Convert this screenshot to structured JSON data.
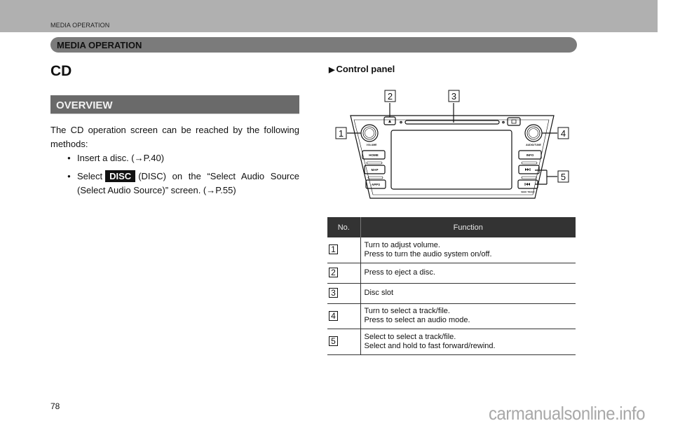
{
  "header": {
    "running_head": "MEDIA OPERATION",
    "section_title": "MEDIA OPERATION"
  },
  "left": {
    "title": "CD",
    "overview_heading": "OVERVIEW",
    "intro": "The CD operation screen can be reached by the following methods:",
    "bullets": [
      {
        "text": "Insert a disc. (→P.40)"
      },
      {
        "before": "Select",
        "badge": "DISC",
        "after": "(DISC) on the “Select Audio Source (Select Audio Source)” screen. (→P.55)"
      }
    ]
  },
  "right": {
    "control_panel_title": "Control panel",
    "diagram": {
      "callouts": [
        "1",
        "2",
        "3",
        "4",
        "5"
      ],
      "buttons": {
        "home": "HOME",
        "map": "MAP",
        "apps": "APPS",
        "info": "INFO",
        "seek_label": "SEEK TRACK",
        "volume_label": "VOLUME",
        "audio_tune_label": "AUDIO/TUNE"
      }
    },
    "table": {
      "headers": [
        "No.",
        "Function"
      ],
      "rows": [
        {
          "no": "1",
          "lines": [
            "Turn to adjust volume.",
            "Press to turn the audio system on/off."
          ]
        },
        {
          "no": "2",
          "lines": [
            "Press to eject a disc."
          ]
        },
        {
          "no": "3",
          "lines": [
            "Disc slot"
          ]
        },
        {
          "no": "4",
          "lines": [
            "Turn to select a track/file.",
            "Press to select an audio mode."
          ]
        },
        {
          "no": "5",
          "lines": [
            "Select to select a track/file.",
            "Select and hold to fast forward/rewind."
          ]
        }
      ]
    }
  },
  "footer": {
    "page_number": "78",
    "watermark": "carmanualsonline.info"
  }
}
